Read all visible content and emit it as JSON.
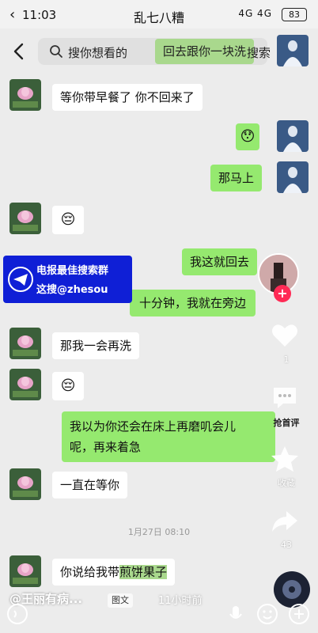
{
  "status": {
    "time": "11:03",
    "title": "乱七八糟",
    "signal": "4G 4G",
    "battery": "83"
  },
  "search": {
    "placeholder": "搜你想看的",
    "highlight": "回去跟你一块洗",
    "button": "搜索"
  },
  "messages": [
    {
      "side": "in",
      "text": "等你带早餐了 你不回来了"
    },
    {
      "side": "out",
      "text": "😯"
    },
    {
      "side": "out",
      "text": "那马上"
    },
    {
      "side": "in",
      "text": "😔"
    },
    {
      "side": "out",
      "text": "我这就回去"
    },
    {
      "side": "out",
      "text": "十分钟，我就在旁边"
    },
    {
      "side": "in",
      "text": "那我一会再洗"
    },
    {
      "side": "in",
      "text": "😔"
    },
    {
      "side": "out",
      "line1": "我以为你还会在床上再磨叽会儿",
      "line2": "呢，再来着急"
    },
    {
      "side": "in",
      "text": "一直在等你"
    },
    {
      "side": "in",
      "text_before": "你说给我带",
      "text_hl": "煎饼果子"
    }
  ],
  "timestamp": "1月27日 08:10",
  "ad": {
    "line1": "电报最佳搜索群",
    "line2": "这搜@zhesou"
  },
  "side": {
    "like_count": "1",
    "comment_label": "抢首评",
    "favorite_label": "收藏",
    "share_count": "43"
  },
  "bottom": {
    "author": "@王丽有病...",
    "tag": "图文",
    "ago": "11小时前"
  },
  "colors": {
    "outgoing_bubble": "#95e96f",
    "incoming_bubble": "#ffffff",
    "ad_background": "#0f1fd6",
    "follow_plus": "#ff2a55"
  }
}
